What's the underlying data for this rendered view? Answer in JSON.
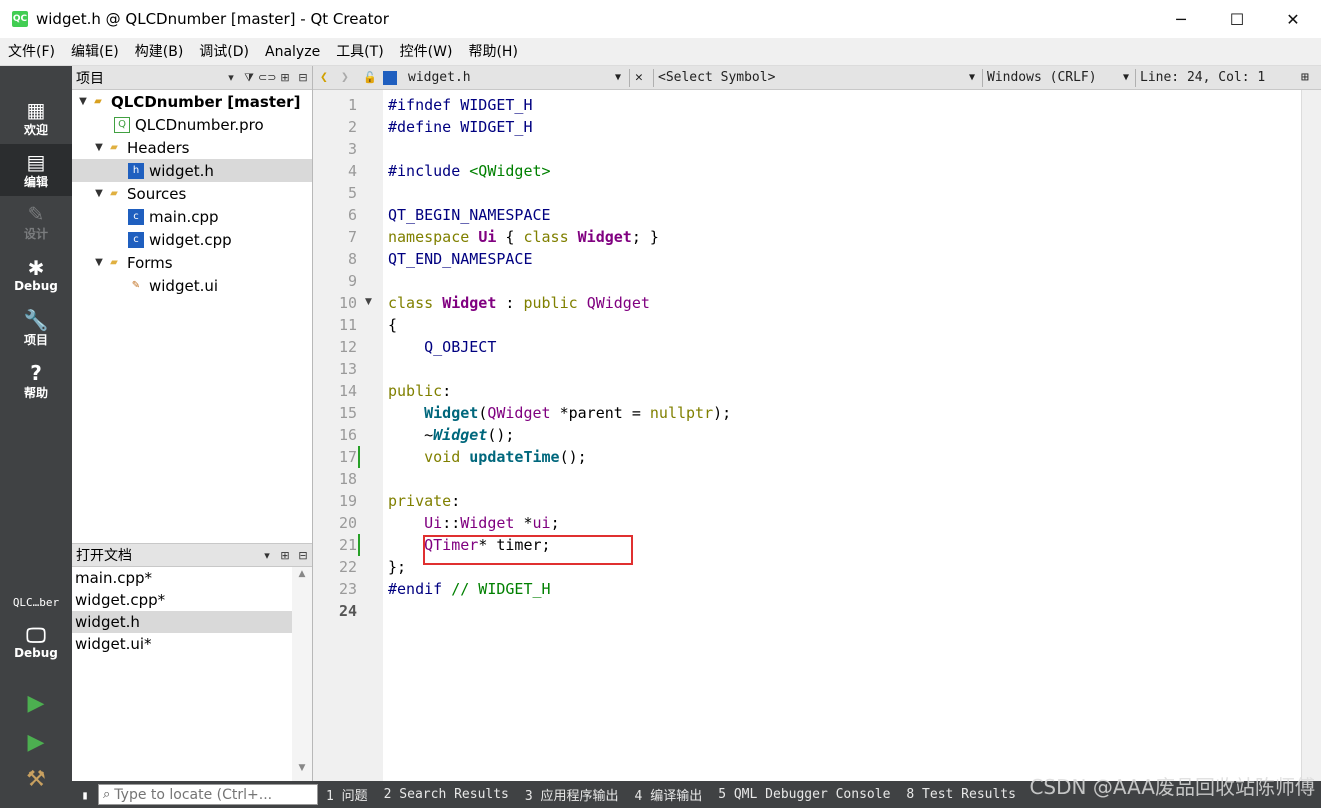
{
  "window": {
    "app_icon": "QC",
    "title": "widget.h @ QLCDnumber [master] - Qt Creator",
    "minimize": "─",
    "maximize": "☐",
    "close": "✕"
  },
  "menu": [
    "文件(F)",
    "编辑(E)",
    "构建(B)",
    "调试(D)",
    "Analyze",
    "工具(T)",
    "控件(W)",
    "帮助(H)"
  ],
  "modes": {
    "welcome": "欢迎",
    "edit": "编辑",
    "design": "设计",
    "debug": "Debug",
    "projects": "项目",
    "help": "帮助",
    "target_project": "QLC…ber",
    "target_config": "Debug"
  },
  "project_pane": {
    "title": "项目",
    "tree": {
      "root": "QLCDnumber [master]",
      "pro_file": "QLCDnumber.pro",
      "headers": "Headers",
      "header_file": "widget.h",
      "sources": "Sources",
      "source_main": "main.cpp",
      "source_widget": "widget.cpp",
      "forms": "Forms",
      "form_file": "widget.ui"
    }
  },
  "open_docs": {
    "title": "打开文档",
    "items": [
      "main.cpp*",
      "widget.cpp*",
      "widget.h",
      "widget.ui*"
    ]
  },
  "editor_toolbar": {
    "file": "widget.h",
    "symbol": "<Select Symbol>",
    "line_ending": "Windows (CRLF)",
    "position": "Line: 24, Col: 1"
  },
  "editor": {
    "line_numbers": [
      "1",
      "2",
      "3",
      "4",
      "5",
      "6",
      "7",
      "8",
      "9",
      "10",
      "11",
      "12",
      "13",
      "14",
      "15",
      "16",
      "17",
      "18",
      "19",
      "20",
      "21",
      "22",
      "23",
      "24"
    ],
    "lines": {
      "l1a": "#ifndef",
      "l1b": "WIDGET_H",
      "l2a": "#define",
      "l2b": "WIDGET_H",
      "l4a": "#include",
      "l4b": "<QWidget>",
      "l6": "QT_BEGIN_NAMESPACE",
      "l7a": "namespace",
      "l7b": "Ui",
      "l7c": " { ",
      "l7d": "class",
      "l7e": "Widget",
      "l7f": "; }",
      "l8": "QT_END_NAMESPACE",
      "l10a": "class",
      "l10b": "Widget",
      "l10c": " : ",
      "l10d": "public",
      "l10e": "QWidget",
      "l11": "{",
      "l12": "Q_OBJECT",
      "l14a": "public",
      "l14b": ":",
      "l15a": "Widget",
      "l15b": "(",
      "l15c": "QWidget",
      "l15d": " *parent = ",
      "l15e": "nullptr",
      "l15f": ");",
      "l16a": "~",
      "l16b": "Widget",
      "l16c": "();",
      "l17a": "void",
      "l17b": "updateTime",
      "l17c": "();",
      "l19a": "private",
      "l19b": ":",
      "l20a": "Ui",
      "l20b": "::",
      "l20c": "Widget",
      "l20d": " *",
      "l20e": "ui",
      "l20f": ";",
      "l21a": "QTimer",
      "l21b": "* ",
      "l21c": "timer",
      "l21d": ";",
      "l22": "};",
      "l23a": "#endif",
      "l23b": "// WIDGET_H"
    }
  },
  "statusbar": {
    "locator_placeholder": "Type to locate (Ctrl+...",
    "tabs": [
      "1 问题",
      "2 Search Results",
      "3 应用程序输出",
      "4 编译输出",
      "5 QML Debugger Console",
      "8 Test Results"
    ]
  },
  "watermark": "CSDN @AAA废品回收站陈师傅",
  "colors": {
    "modebar_bg": "#404244",
    "keyword": "#808000",
    "preprocessor": "#000080",
    "type": "#800080",
    "string": "#008000",
    "function": "#00677c",
    "highlight_box": "#e03030"
  }
}
